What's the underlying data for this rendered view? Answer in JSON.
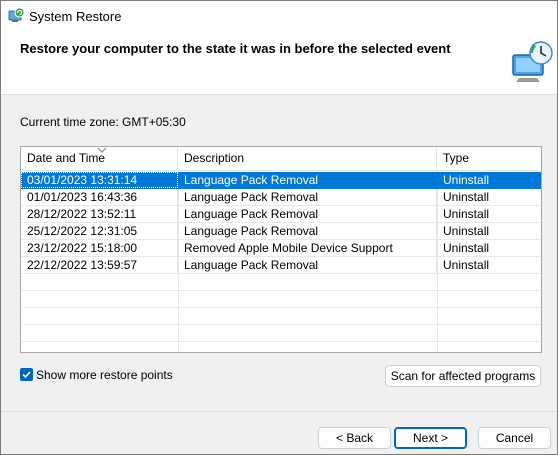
{
  "window": {
    "title": "System Restore"
  },
  "header": {
    "title": "Restore your computer to the state it was in before the selected event"
  },
  "timezone": {
    "label": "Current time zone: GMT+05:30"
  },
  "table": {
    "columns": [
      "Date and Time",
      "Description",
      "Type"
    ],
    "rows": [
      {
        "date": "03/01/2023 13:31:14",
        "description": "Language Pack Removal",
        "type": "Uninstall",
        "selected": true
      },
      {
        "date": "01/01/2023 16:43:36",
        "description": "Language Pack Removal",
        "type": "Uninstall"
      },
      {
        "date": "28/12/2022 13:52:11",
        "description": "Language Pack Removal",
        "type": "Uninstall"
      },
      {
        "date": "25/12/2022 12:31:05",
        "description": "Language Pack Removal",
        "type": "Uninstall"
      },
      {
        "date": "23/12/2022 15:18:00",
        "description": "Removed Apple Mobile Device Support",
        "type": "Uninstall"
      },
      {
        "date": "22/12/2022 13:59:57",
        "description": "Language Pack Removal",
        "type": "Uninstall"
      }
    ]
  },
  "options": {
    "show_more_label": "Show more restore points",
    "show_more_checked": true
  },
  "buttons": {
    "scan": "Scan for affected programs",
    "back": "< Back",
    "next": "Next >",
    "cancel": "Cancel"
  },
  "icons": {
    "title": "system-restore-icon",
    "header": "computer-restore-icon",
    "sort": "chevron-down-icon"
  },
  "colors": {
    "selection": "#0078d7",
    "accent": "#0067c0"
  }
}
